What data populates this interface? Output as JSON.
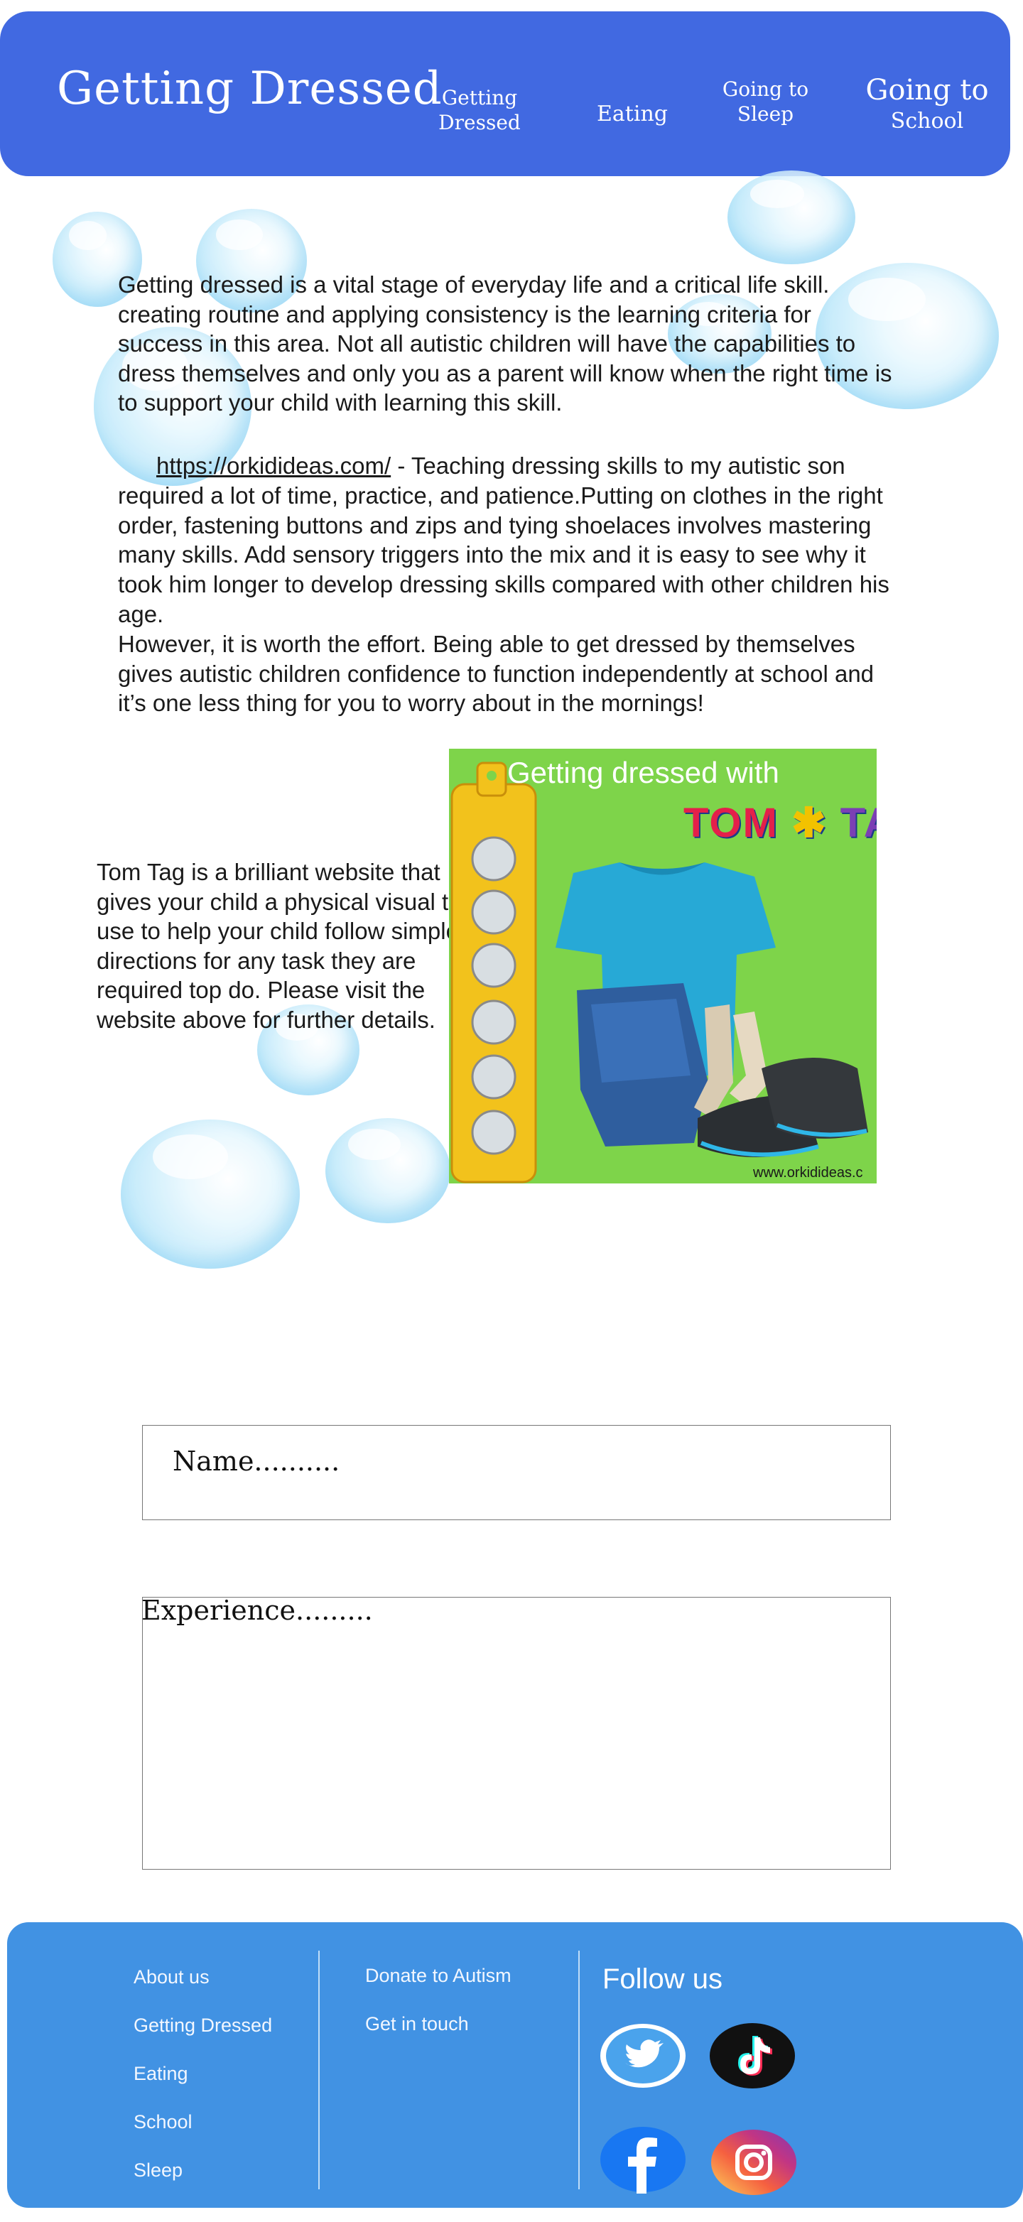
{
  "header": {
    "title": "Getting Dressed",
    "nav": [
      {
        "line1": "Getting",
        "line2": "Dressed"
      },
      {
        "line1": "Eating",
        "line2": ""
      },
      {
        "line1": "Going to",
        "line2": "Sleep"
      },
      {
        "line1": "Going to",
        "line2": "School"
      }
    ]
  },
  "intro": {
    "text": "Getting dressed is a vital stage of everyday life and a critical life skill. creating routine and applying consistency is the learning criteria for success in this area. Not all autistic children will have the capabilities to dress themselves and only you as a parent will know when the right time is to support your child with learning this skill."
  },
  "article": {
    "link": "https://orkidideas.com/",
    "text1": " - Teaching dressing skills to my autistic son required a lot of time, practice, and patience.Putting on clothes in the right order, fastening buttons and zips and tying shoelaces involves mastering many skills. Add sensory triggers into the mix and it is easy to see why it took him longer to develop dressing skills compared with other children his age.",
    "text2": "However, it is worth the effort. Being able to get dressed by themselves gives autistic children confidence to function independently at school and it’s one less thing for you to worry about in the mornings!"
  },
  "tomtag": {
    "text": "Tom Tag is a brilliant website that gives your child a physical visual to use to help your child follow simple directions for any task they are required top do. Please visit the website above for further details."
  },
  "illustration": {
    "title": "Getting dressed with",
    "logo_part1": "TOM",
    "logo_star": "✱",
    "logo_part2": "TA",
    "url": "www.orkidideas.c"
  },
  "form": {
    "name_label": "Name..........",
    "experience_label": "Experience........."
  },
  "footer": {
    "col1": [
      "About us",
      "Getting Dressed",
      "Eating",
      "School",
      "Sleep"
    ],
    "col2": [
      "Donate to Autism",
      "Get in touch"
    ],
    "follow": "Follow us",
    "social": [
      "twitter-icon",
      "tiktok-icon",
      "facebook-icon",
      "instagram-icon"
    ]
  },
  "colors": {
    "header": "#4169e1",
    "footer": "#4192e3",
    "illustration_bg": "#7ed44a"
  }
}
